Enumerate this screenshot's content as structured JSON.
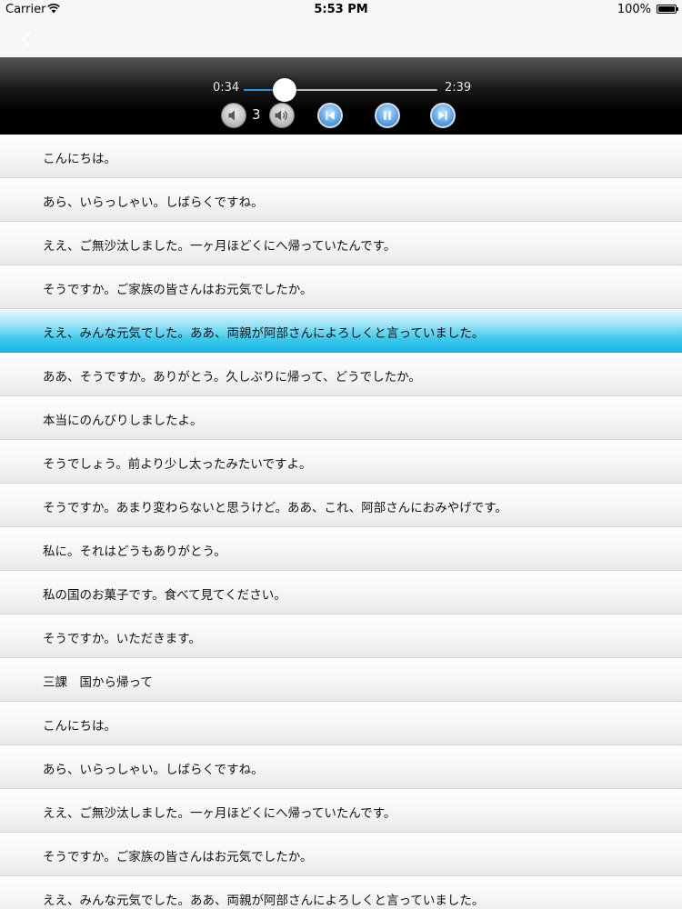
{
  "status_bar": {
    "carrier": "Carrier",
    "time": "5:53 PM",
    "battery": "100%"
  },
  "player": {
    "current_time": "0:34",
    "total_time": "2:39",
    "progress": 0.213,
    "volume": "3",
    "accent_color": "#2a8fe0"
  },
  "transcript": {
    "active_index": 4,
    "lines": [
      "こんにちは。",
      "あら、いらっしゃい。しばらくですね。",
      "ええ、ご無沙汰しました。一ヶ月ほどくにへ帰っていたんです。",
      "そうですか。ご家族の皆さんはお元気でしたか。",
      "ええ、みんな元気でした。ああ、両親が阿部さんによろしくと言っていました。",
      "ああ、そうですか。ありがとう。久しぶりに帰って、どうでしたか。",
      "本当にのんびりしましたよ。",
      "そうでしょう。前より少し太ったみたいですよ。",
      "そうですか。あまり変わらないと思うけど。ああ、これ、阿部さんにおみやげです。",
      "私に。それはどうもありがとう。",
      "私の国のお菓子です。食べて見てください。",
      "そうですか。いただきます。",
      "三課　国から帰って",
      "こんにちは。",
      "あら、いらっしゃい。しばらくですね。",
      "ええ、ご無沙汰しました。一ヶ月ほどくにへ帰っていたんです。",
      "そうですか。ご家族の皆さんはお元気でしたか。",
      "ええ、みんな元気でした。ああ、両親が阿部さんによろしくと言っていました。"
    ]
  }
}
